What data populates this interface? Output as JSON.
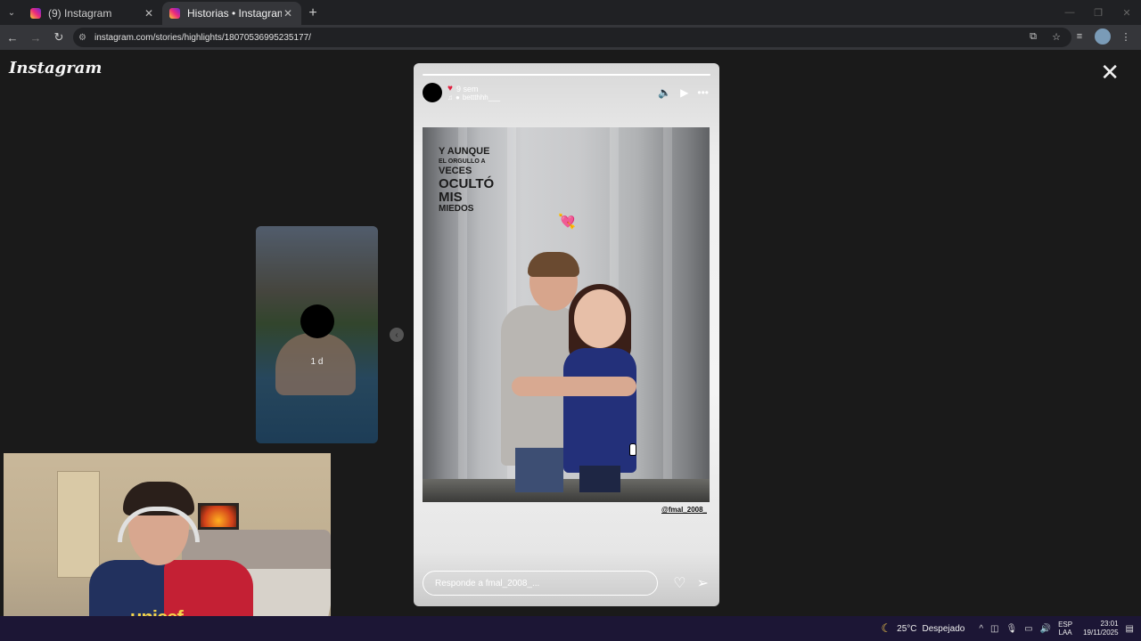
{
  "browser": {
    "tabs": [
      {
        "label": "(9) Instagram",
        "active": false
      },
      {
        "label": "Historias • Instagram",
        "active": true
      }
    ],
    "url": "instagram.com/stories/highlights/18070536995235177/"
  },
  "instagram": {
    "logo": "Instagram",
    "previous_story": {
      "time": "1 d"
    },
    "story": {
      "time_ago": "9 sem",
      "audio_user": "bettthhh___",
      "caption_lines": [
        "Y AUNQUE",
        "EL ORGULLO A",
        "VECES",
        "OCULTÓ",
        "MIS",
        "MIEDOS"
      ],
      "mention": "@fmal_2008_",
      "reply_placeholder": "Responde a fmal_2008_..."
    }
  },
  "taskbar": {
    "temperature": "25°C",
    "weather": "Despejado",
    "lang_top": "ESP",
    "lang_bottom": "LAA",
    "time": "23:01",
    "date": "19/11/2025"
  },
  "colors": {
    "accent_heart": "#e02040",
    "taskbar": "#1c1635",
    "browser_bg": "#202124"
  }
}
